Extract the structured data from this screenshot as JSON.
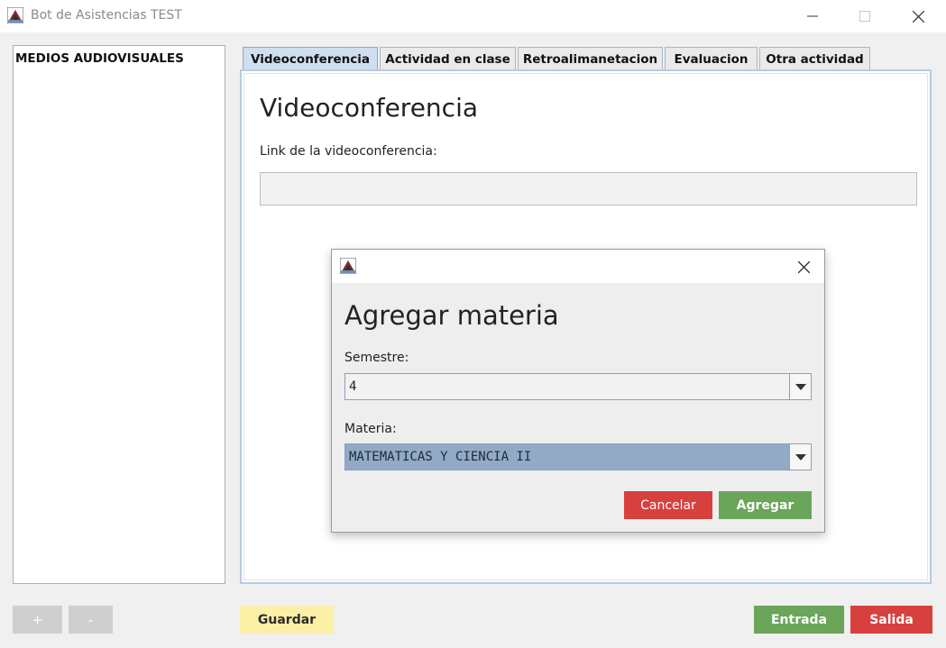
{
  "window": {
    "title": "Bot de Asistencias TEST",
    "icons": {
      "app": "app-icon",
      "minimize": "minimize-icon",
      "maximize": "maximize-icon",
      "close": "close-icon"
    }
  },
  "sidebar": {
    "items": [
      {
        "label": "MEDIOS AUDIOVISUALES"
      }
    ]
  },
  "tabs": [
    {
      "label": "Videoconferencia",
      "active": true
    },
    {
      "label": "Actividad en clase",
      "active": false
    },
    {
      "label": "Retroalimanetacion",
      "active": false
    },
    {
      "label": "Evaluacion",
      "active": false
    },
    {
      "label": "Otra actividad",
      "active": false
    }
  ],
  "panel": {
    "title": "Videoconferencia",
    "link_label": "Link de la videoconferencia:",
    "link_value": ""
  },
  "bottom_bar": {
    "add_label": "+",
    "remove_label": "-",
    "save_label": "Guardar",
    "entry_label": "Entrada",
    "exit_label": "Salida"
  },
  "dialog": {
    "title": "Agregar materia",
    "semester_label": "Semestre:",
    "semester_value": "4",
    "subject_label": "Materia:",
    "subject_value": "MATEMATICAS Y CIENCIA II",
    "cancel_label": "Cancelar",
    "add_label": "Agregar"
  },
  "colors": {
    "active_tab": "#cfdff0",
    "green_button": "#6aa55a",
    "red_button": "#d8403e",
    "yellow_button": "#fcefa6",
    "gray_button": "#cfcfcf",
    "selected_combo": "#92aac6"
  }
}
